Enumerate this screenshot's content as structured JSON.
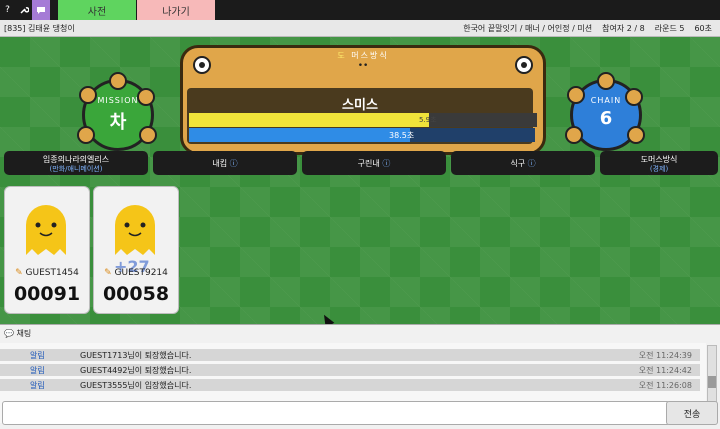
{
  "topbar": {
    "icons": [
      {
        "name": "help-icon",
        "glyph": "?"
      },
      {
        "name": "wrench-icon",
        "glyph": "🔧"
      },
      {
        "name": "chat-bubble-icon",
        "glyph": "💬"
      }
    ],
    "dict_label": "사전",
    "exit_label": "나가기",
    "colors": {
      "dict": "#5fd45f",
      "exit": "#f7b9b9",
      "chat": "#a57bd6"
    }
  },
  "room": {
    "info": "[835] 김태윤 댕청이",
    "mode": "한국어 끝말잇기 / 매너 / 어인정 / 미션",
    "players": "참여자 2 / 8",
    "round": "라운드 5",
    "time": "60초"
  },
  "game": {
    "board_title_first": "도",
    "board_title_rest": "머스방식",
    "hint_dots": "••",
    "current_word": "스미스",
    "turn_time": "5.9초",
    "turn_ratio": 0.69,
    "round_time": "38.5초",
    "round_ratio": 0.64,
    "mission_label": "MISSION",
    "mission_char": "차",
    "chain_label": "CHAIN",
    "chain_value": "6"
  },
  "history": [
    {
      "word": "임종의나라의엘리스",
      "meaning": "(만화/애니메이션)"
    },
    {
      "word": "내킴",
      "meaning": "ⓘ"
    },
    {
      "word": "구린내",
      "meaning": "ⓘ"
    },
    {
      "word": "식구",
      "meaning": "ⓘ"
    },
    {
      "word": "도머스방식",
      "meaning": "(경제)"
    }
  ],
  "players": [
    {
      "name": "GUEST1454",
      "score": "00091",
      "plus": ""
    },
    {
      "name": "GUEST9214",
      "score": "00058",
      "plus": "+27"
    }
  ],
  "chat": {
    "header": "채팅",
    "messages": [
      {
        "who": "알림",
        "text": "GUEST1713님이 퇴장했습니다.",
        "time": "오전 11:24:39"
      },
      {
        "who": "알림",
        "text": "GUEST4492님이 퇴장했습니다.",
        "time": "오전 11:24:42"
      },
      {
        "who": "알림",
        "text": "GUEST3555님이 입장했습니다.",
        "time": "오전 11:26:08"
      }
    ],
    "input_placeholder": "",
    "send_label": "전송"
  }
}
